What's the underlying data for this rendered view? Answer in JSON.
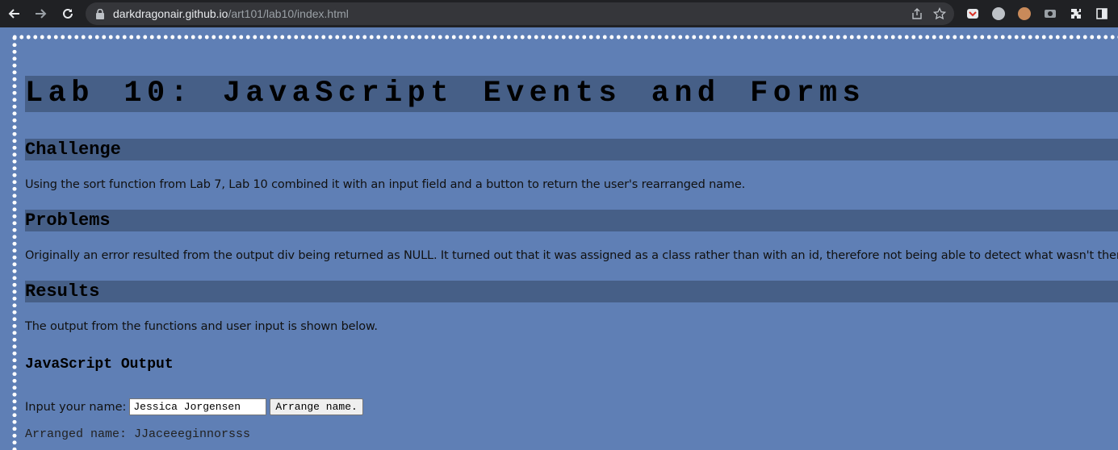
{
  "browser": {
    "url_host": "darkdragonair.github.io",
    "url_path": "/art101/lab10/index.html",
    "icons": [
      "back-icon",
      "forward-icon",
      "reload-icon",
      "lock-icon",
      "share-icon",
      "star-icon",
      "extensions-icon",
      "side-panel-icon"
    ]
  },
  "page": {
    "title": "Lab 10: JavaScript Events and Forms",
    "sections": [
      {
        "heading": "Challenge",
        "text": "Using the sort function from Lab 7, Lab 10 combined it with an input field and a button to return the user's rearranged name."
      },
      {
        "heading": "Problems",
        "text": "Originally an error resulted from the output div being returned as NULL. It turned out that it was assigned as a class rather than with an id, therefore not being able to detect what wasn't there."
      },
      {
        "heading": "Results",
        "text": "The output from the functions and user input is shown below."
      }
    ],
    "output_heading": "JavaScript Output",
    "form": {
      "label": "Input your name:",
      "input_value": "Jessica Jorgensen",
      "button_label": "Arrange name."
    },
    "result": "Arranged name: JJaceeeginnorsss"
  },
  "colors": {
    "page_bg": "#5f7fb5",
    "heading_bar": "#465f87",
    "chrome_bg": "#202124"
  }
}
